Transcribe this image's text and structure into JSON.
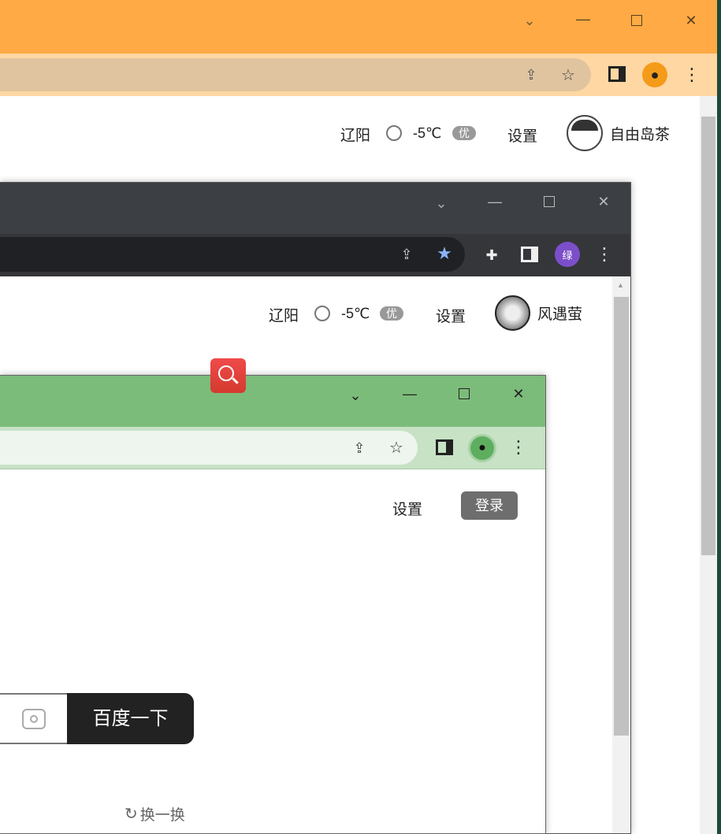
{
  "window_back": {
    "header": {
      "city": "辽阳",
      "temperature": "-5℃",
      "air_quality": "优",
      "settings": "设置",
      "username": "自由岛茶"
    },
    "colors": {
      "titlebar": "#ffaa44",
      "toolbar": "#ffd7a3",
      "omnibox": "#e0c4a0"
    }
  },
  "window_middle": {
    "header": {
      "city": "辽阳",
      "temperature": "-5℃",
      "air_quality": "优",
      "settings": "设置",
      "username": "风遇萤"
    },
    "profile_initial": "绿",
    "colors": {
      "titlebar": "#3c3f43",
      "toolbar": "#35363a",
      "omnibox": "#202124"
    }
  },
  "window_front": {
    "header": {
      "settings": "设置",
      "login": "登录"
    },
    "search_button": "百度一下",
    "refresh_label": "换一换",
    "colors": {
      "titlebar": "#7cbc7a",
      "toolbar": "#c7e2c5",
      "omnibox": "#eef5ee"
    }
  }
}
